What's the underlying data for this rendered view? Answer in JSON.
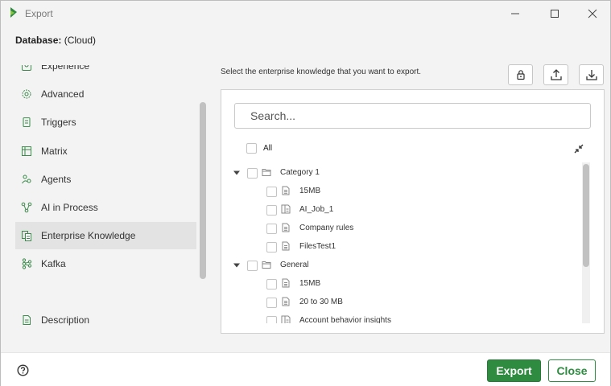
{
  "window": {
    "title": "Export",
    "accent": "#2e8b40"
  },
  "database": {
    "label": "Database:",
    "value": "(Cloud)"
  },
  "sidebar": {
    "items": [
      {
        "label": "Experience",
        "icon": "experience-icon"
      },
      {
        "label": "Advanced",
        "icon": "gear-icon"
      },
      {
        "label": "Triggers",
        "icon": "triggers-icon"
      },
      {
        "label": "Matrix",
        "icon": "matrix-icon"
      },
      {
        "label": "Agents",
        "icon": "agents-icon"
      },
      {
        "label": "AI in Process",
        "icon": "ai-process-icon"
      },
      {
        "label": "Enterprise Knowledge",
        "icon": "knowledge-icon",
        "active": true
      },
      {
        "label": "Kafka",
        "icon": "kafka-icon"
      }
    ],
    "description": {
      "label": "Description",
      "icon": "document-icon"
    }
  },
  "panel": {
    "instructions": "Select the enterprise knowledge that you want to export.",
    "toolbar": [
      "lock-icon",
      "upload-icon",
      "download-icon"
    ],
    "search": {
      "placeholder": "Search...",
      "value": ""
    },
    "all_label": "All",
    "tree": [
      {
        "label": "Category 1",
        "type": "folder",
        "expanded": true,
        "children": [
          {
            "label": "15MB",
            "type": "file"
          },
          {
            "label": "AI_Job_1",
            "type": "structured-file"
          },
          {
            "label": "Company rules",
            "type": "file"
          },
          {
            "label": "FilesTest1",
            "type": "file"
          }
        ]
      },
      {
        "label": "General",
        "type": "folder",
        "expanded": true,
        "children": [
          {
            "label": "15MB",
            "type": "file"
          },
          {
            "label": "20 to 30 MB",
            "type": "file"
          },
          {
            "label": "Account behavior insights",
            "type": "structured-file"
          }
        ]
      }
    ]
  },
  "footer": {
    "export_label": "Export",
    "close_label": "Close",
    "help_icon": "help-icon"
  }
}
